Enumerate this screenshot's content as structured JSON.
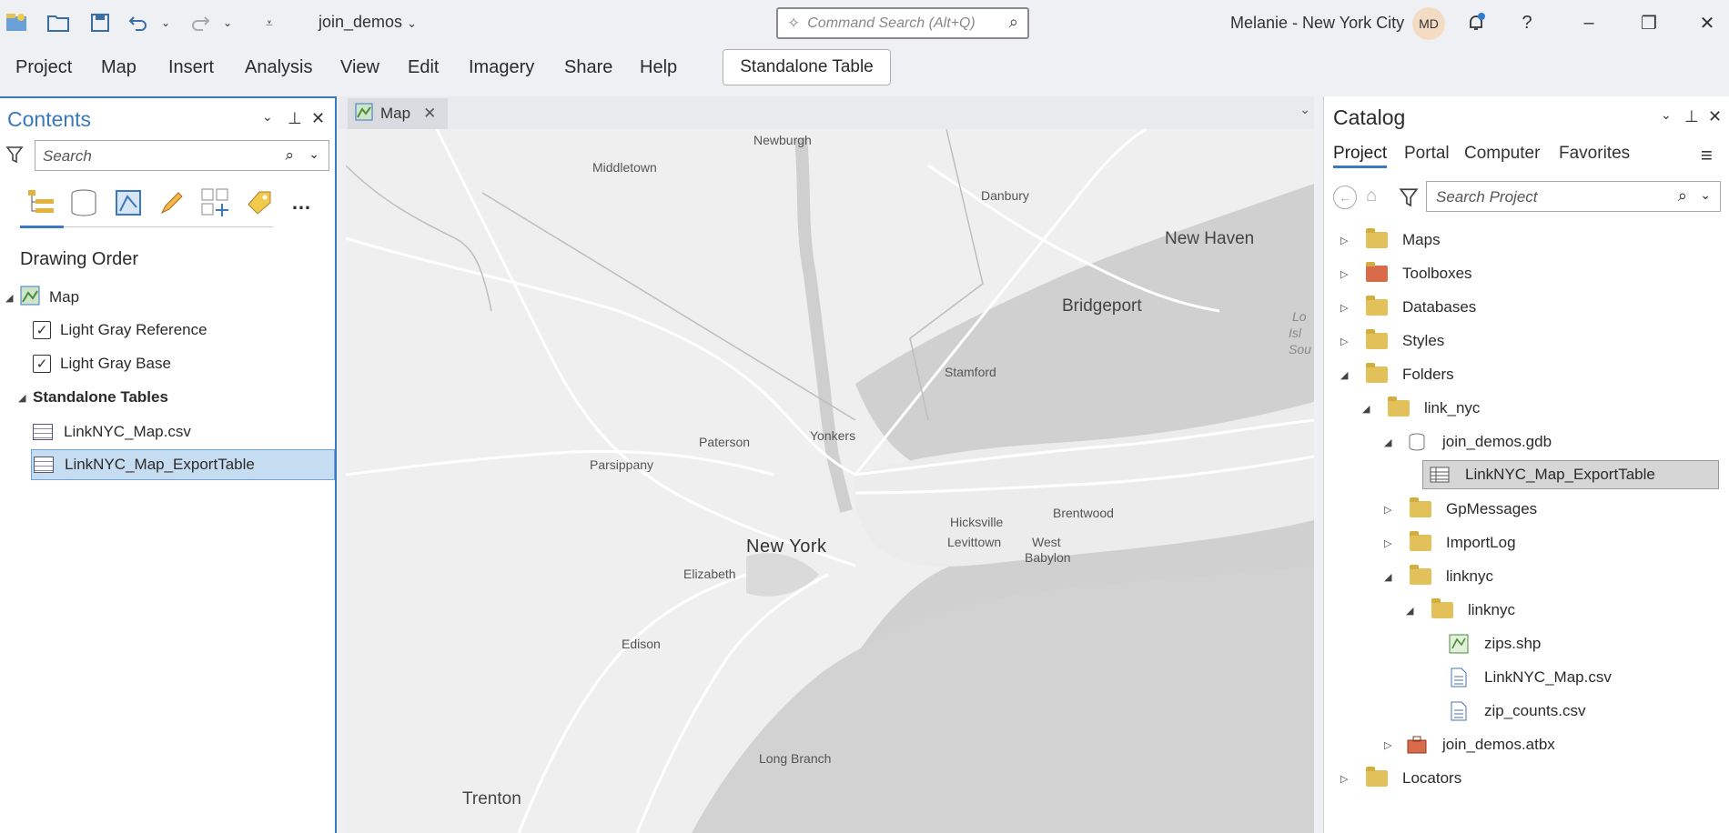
{
  "titlebar": {
    "project_name": "join_demos",
    "command_search_placeholder": "Command Search (Alt+Q)",
    "user_name": "Melanie - New York City",
    "avatar_initials": "MD"
  },
  "menu": {
    "items": [
      "Project",
      "Map",
      "Insert",
      "Analysis",
      "View",
      "Edit",
      "Imagery",
      "Share",
      "Help"
    ],
    "contextual_tab": "Standalone Table"
  },
  "contents": {
    "title": "Contents",
    "search_placeholder": "Search",
    "section_heading": "Drawing Order",
    "map_label": "Map",
    "layers": [
      "Light Gray Reference",
      "Light Gray Base"
    ],
    "standalone_heading": "Standalone Tables",
    "tables": [
      "LinkNYC_Map.csv",
      "LinkNYC_Map_ExportTable"
    ]
  },
  "map_view": {
    "tab_label": "Map",
    "places": {
      "newburgh": "Newburgh",
      "middletown": "Middletown",
      "danbury": "Danbury",
      "new_haven": "New Haven",
      "bridgeport": "Bridgeport",
      "stamford": "Stamford",
      "paterson": "Paterson",
      "yonkers": "Yonkers",
      "parsippany": "Parsippany",
      "hicksville": "Hicksville",
      "levittown": "Levittown",
      "brentwood": "Brentwood",
      "west": "West",
      "babylon": "Babylon",
      "new_york": "New York",
      "elizabeth": "Elizabeth",
      "edison": "Edison",
      "long_branch": "Long Branch",
      "trenton": "Trenton",
      "lo": "Lo",
      "isl": "Isl",
      "sou": "Sou"
    }
  },
  "catalog": {
    "title": "Catalog",
    "tabs": [
      "Project",
      "Portal",
      "Computer",
      "Favorites"
    ],
    "search_placeholder": "Search Project",
    "items": {
      "maps": "Maps",
      "toolboxes": "Toolboxes",
      "databases": "Databases",
      "styles": "Styles",
      "folders": "Folders",
      "link_nyc": "link_nyc",
      "join_demos_gdb": "join_demos.gdb",
      "export_table": "LinkNYC_Map_ExportTable",
      "gpmessages": "GpMessages",
      "importlog": "ImportLog",
      "linknyc": "linknyc",
      "linknyc_sub": "linknyc",
      "zips_shp": "zips.shp",
      "linknyc_csv": "LinkNYC_Map.csv",
      "zip_counts": "zip_counts.csv",
      "join_demos_atbx": "join_demos.atbx",
      "locators": "Locators"
    }
  }
}
